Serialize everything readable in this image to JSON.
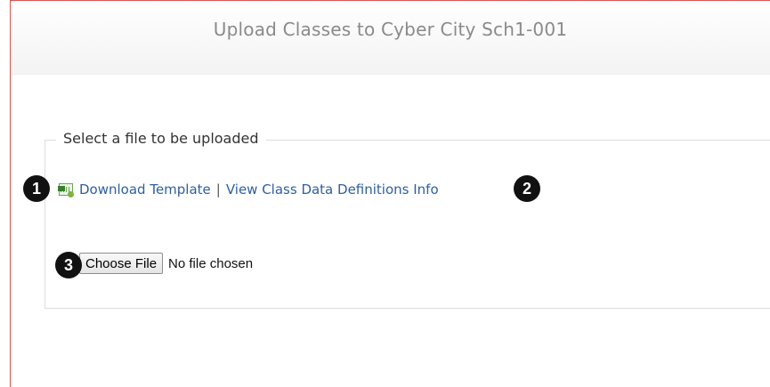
{
  "dialog": {
    "title": "Upload Classes to Cyber City Sch1-001"
  },
  "upload_section": {
    "legend": "Select a file to be uploaded",
    "download_template_label": "Download Template",
    "separator": "|",
    "view_definitions_label": "View Class Data Definitions Info",
    "choose_file_label": "Choose File",
    "file_status": "No file chosen"
  },
  "callouts": [
    "1",
    "2",
    "3"
  ],
  "colors": {
    "link": "#2e5f9e",
    "title": "#8a8a8a",
    "dialog_border": "#d9534f",
    "badge": "#111111"
  },
  "icons": [
    "excel-file-icon"
  ]
}
